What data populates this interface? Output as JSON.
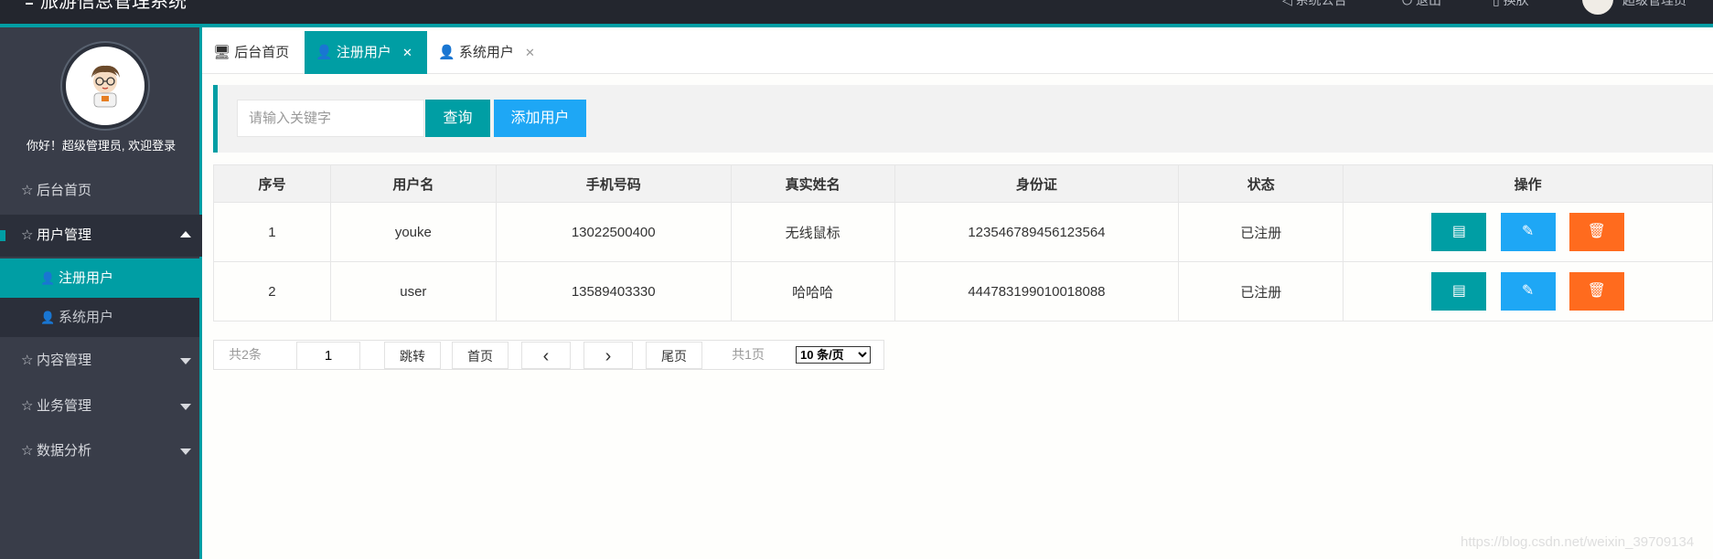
{
  "header": {
    "title": "旅游信息管理系统",
    "links": [
      {
        "icon": "announcement-icon",
        "label": "系统公告"
      },
      {
        "icon": "logout-icon",
        "label": "退出"
      },
      {
        "icon": "theme-icon",
        "label": "换肤"
      }
    ],
    "user_label": "超级管理员"
  },
  "sidebar": {
    "greeting": "你好！超级管理员, 欢迎登录",
    "items": [
      {
        "label": "后台首页",
        "expanded": false
      },
      {
        "label": "用户管理",
        "expanded": true,
        "children": [
          {
            "label": "注册用户",
            "selected": true
          },
          {
            "label": "系统用户",
            "selected": false
          }
        ]
      },
      {
        "label": "内容管理",
        "expanded": false
      },
      {
        "label": "业务管理",
        "expanded": false
      },
      {
        "label": "数据分析",
        "expanded": false
      }
    ]
  },
  "tabs": [
    {
      "icon": "monitor-icon",
      "label": "后台首页",
      "closable": false,
      "active": false
    },
    {
      "icon": "user-icon",
      "label": "注册用户",
      "closable": true,
      "active": true
    },
    {
      "icon": "user-icon",
      "label": "系统用户",
      "closable": true,
      "active": false
    }
  ],
  "toolbar": {
    "search_placeholder": "请输入关键字",
    "search_value": "",
    "query_label": "查询",
    "add_label": "添加用户"
  },
  "table": {
    "columns": [
      "序号",
      "用户名",
      "手机号码",
      "真实姓名",
      "身份证",
      "状态",
      "操作"
    ],
    "rows": [
      [
        "1",
        "youke",
        "13022500400",
        "无线鼠标",
        "123546789456123564",
        "已注册"
      ],
      [
        "2",
        "user",
        "13589403330",
        "哈哈哈",
        "444783199010018088",
        "已注册"
      ]
    ],
    "row_actions": [
      {
        "icon": "document-icon",
        "color": "#009ea4"
      },
      {
        "icon": "edit-icon",
        "color": "#1ea7f5"
      },
      {
        "icon": "delete-icon",
        "color": "#ff6b1e"
      }
    ]
  },
  "pager": {
    "total": "共2条",
    "current_page": "1",
    "jump": "跳转",
    "first": "首页",
    "last": "尾页",
    "pages": "共1页",
    "page_size": "10 条/页"
  },
  "colors": {
    "accent": "#009ea4",
    "header_bg": "#23262e",
    "sidebar_bg": "#393d49",
    "add_button": "#1ea7f5",
    "delete_button": "#ff6b1e"
  },
  "watermark": "https://blog.csdn.net/weixin_39709134"
}
